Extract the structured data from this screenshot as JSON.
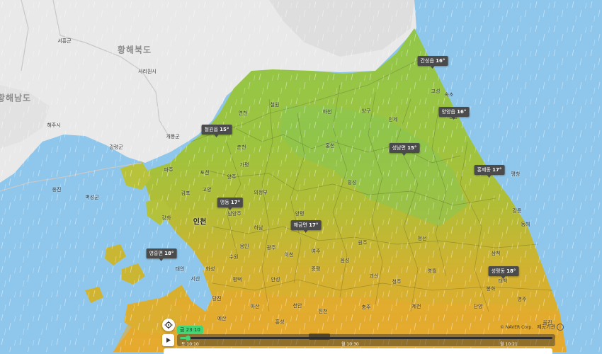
{
  "place_labels": [
    {
      "text": "황해북도",
      "kind": "big"
    },
    {
      "text": "황해남도",
      "kind": "big"
    },
    {
      "text": "인천",
      "kind": "city"
    },
    {
      "text": "서흥군",
      "kind": "small"
    },
    {
      "text": "개풍군",
      "kind": "small"
    },
    {
      "text": "사리원시",
      "kind": "small"
    },
    {
      "text": "해주시",
      "kind": "small"
    },
    {
      "text": "강령군",
      "kind": "small"
    },
    {
      "text": "벽성군",
      "kind": "small"
    },
    {
      "text": "연천",
      "kind": "small"
    },
    {
      "text": "철원",
      "kind": "small"
    },
    {
      "text": "화천",
      "kind": "small"
    },
    {
      "text": "양구",
      "kind": "small"
    },
    {
      "text": "인제",
      "kind": "small"
    },
    {
      "text": "고성",
      "kind": "small"
    },
    {
      "text": "속초",
      "kind": "small"
    },
    {
      "text": "양양",
      "kind": "small"
    },
    {
      "text": "춘천",
      "kind": "small"
    },
    {
      "text": "홍천",
      "kind": "small"
    },
    {
      "text": "강릉",
      "kind": "small"
    },
    {
      "text": "평창",
      "kind": "small"
    },
    {
      "text": "동해",
      "kind": "small"
    },
    {
      "text": "횡성",
      "kind": "small"
    },
    {
      "text": "원주",
      "kind": "small"
    },
    {
      "text": "영월",
      "kind": "small"
    },
    {
      "text": "정선",
      "kind": "small"
    },
    {
      "text": "삼척",
      "kind": "small"
    },
    {
      "text": "태백",
      "kind": "small"
    },
    {
      "text": "가평",
      "kind": "small"
    },
    {
      "text": "포천",
      "kind": "small"
    },
    {
      "text": "양주",
      "kind": "small"
    },
    {
      "text": "파주",
      "kind": "small"
    },
    {
      "text": "김포",
      "kind": "small"
    },
    {
      "text": "고양",
      "kind": "small"
    },
    {
      "text": "의정부",
      "kind": "small"
    },
    {
      "text": "남양주",
      "kind": "small"
    },
    {
      "text": "양평",
      "kind": "small"
    },
    {
      "text": "하남",
      "kind": "small"
    },
    {
      "text": "광주",
      "kind": "small"
    },
    {
      "text": "여주",
      "kind": "small"
    },
    {
      "text": "이천",
      "kind": "small"
    },
    {
      "text": "용인",
      "kind": "small"
    },
    {
      "text": "수원",
      "kind": "small"
    },
    {
      "text": "화성",
      "kind": "small"
    },
    {
      "text": "평택",
      "kind": "small"
    },
    {
      "text": "안성",
      "kind": "small"
    },
    {
      "text": "충주",
      "kind": "small"
    },
    {
      "text": "제천",
      "kind": "small"
    },
    {
      "text": "단양",
      "kind": "small"
    },
    {
      "text": "음성",
      "kind": "small"
    },
    {
      "text": "진천",
      "kind": "small"
    },
    {
      "text": "천안",
      "kind": "small"
    },
    {
      "text": "아산",
      "kind": "small"
    },
    {
      "text": "당진",
      "kind": "small"
    },
    {
      "text": "서산",
      "kind": "small"
    },
    {
      "text": "태안",
      "kind": "small"
    },
    {
      "text": "청주",
      "kind": "small"
    },
    {
      "text": "증평",
      "kind": "small"
    },
    {
      "text": "괴산",
      "kind": "small"
    },
    {
      "text": "예산",
      "kind": "small"
    },
    {
      "text": "홍성",
      "kind": "small"
    },
    {
      "text": "강화",
      "kind": "small"
    },
    {
      "text": "옹진",
      "kind": "small"
    },
    {
      "text": "영주",
      "kind": "small"
    },
    {
      "text": "봉화",
      "kind": "small"
    },
    {
      "text": "울진",
      "kind": "small"
    }
  ],
  "weather_labels": [
    {
      "place": "간성읍",
      "temp": "16°"
    },
    {
      "place": "양양읍",
      "temp": "16°"
    },
    {
      "place": "철원읍",
      "temp": "15°"
    },
    {
      "place": "성남면",
      "temp": "15°"
    },
    {
      "place": "홍제동",
      "temp": "17°"
    },
    {
      "place": "명동",
      "temp": "17°"
    },
    {
      "place": "해금면",
      "temp": "17°"
    },
    {
      "place": "영흥면",
      "temp": "18°"
    },
    {
      "place": "성평동",
      "temp": "18°"
    }
  ],
  "timeline": {
    "current_time": "금 23:10",
    "ticks": [
      "토 10:10",
      "월 10:30",
      "월 10:21"
    ],
    "progress": 0.02
  },
  "attribution": {
    "credit": "© NAVER Corp.",
    "provider": "제공기관",
    "info_symbol": "i"
  },
  "colors": {
    "sea": "#8fc7ec",
    "north_land": "#e9e9e9",
    "green": "#8ec83f",
    "yellow_green": "#b8c23a",
    "orange": "#e6ad32",
    "accent_green": "#46d576"
  }
}
